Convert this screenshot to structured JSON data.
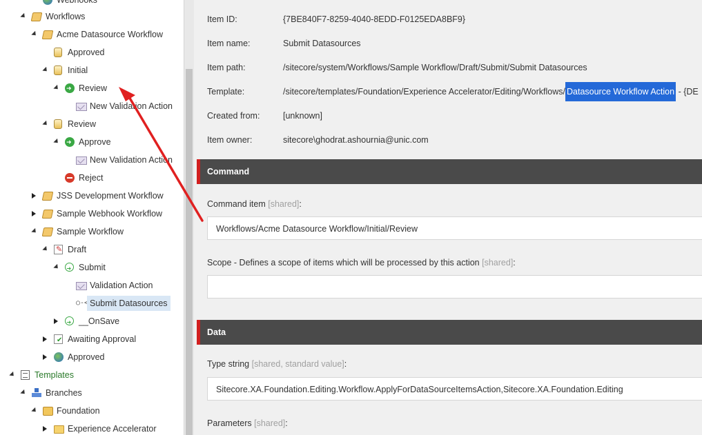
{
  "tree": {
    "nodes": [
      {
        "label": "Webhooks",
        "toggle": "none",
        "icon": "globe-icon"
      },
      {
        "label": "Workflows",
        "toggle": "open",
        "icon": "workflows-folder-icon"
      },
      {
        "label": "Acme Datasource Workflow",
        "toggle": "open",
        "icon": "workflow-icon"
      },
      {
        "label": "Approved",
        "toggle": "none",
        "icon": "workflow-state-icon"
      },
      {
        "label": "Initial",
        "toggle": "open",
        "icon": "workflow-state-icon"
      },
      {
        "label": "Review",
        "toggle": "open",
        "icon": "workflow-command-icon"
      },
      {
        "label": "New Validation Action",
        "toggle": "none",
        "icon": "workflow-action-icon"
      },
      {
        "label": "Review",
        "toggle": "open",
        "icon": "workflow-state-icon"
      },
      {
        "label": "Approve",
        "toggle": "open",
        "icon": "workflow-command-icon"
      },
      {
        "label": "New Validation Action",
        "toggle": "none",
        "icon": "workflow-action-icon"
      },
      {
        "label": "Reject",
        "toggle": "none",
        "icon": "reject-icon"
      },
      {
        "label": "JSS Development Workflow",
        "toggle": "closed",
        "icon": "workflow-icon"
      },
      {
        "label": "Sample Webhook Workflow",
        "toggle": "closed",
        "icon": "workflow-icon"
      },
      {
        "label": "Sample Workflow",
        "toggle": "open",
        "icon": "workflow-icon"
      },
      {
        "label": "Draft",
        "toggle": "open",
        "icon": "draft-icon"
      },
      {
        "label": "Submit",
        "toggle": "open",
        "icon": "workflow-command-outline-icon"
      },
      {
        "label": "Validation Action",
        "toggle": "none",
        "icon": "workflow-action-icon"
      },
      {
        "label": "Submit Datasources",
        "toggle": "none",
        "icon": "connector-icon",
        "selected": true
      },
      {
        "label": "__OnSave",
        "toggle": "closed",
        "icon": "workflow-command-outline-icon"
      },
      {
        "label": "Awaiting Approval",
        "toggle": "closed",
        "icon": "awaiting-approval-icon"
      },
      {
        "label": "Approved",
        "toggle": "closed",
        "icon": "globe-icon"
      },
      {
        "label": "Templates",
        "toggle": "open",
        "icon": "templates-icon"
      },
      {
        "label": "Branches",
        "toggle": "open",
        "icon": "branches-icon"
      },
      {
        "label": "Foundation",
        "toggle": "open",
        "icon": "foundation-folder-icon"
      },
      {
        "label": "Experience Accelerator",
        "toggle": "closed",
        "icon": "folder-icon"
      }
    ]
  },
  "info": {
    "item_id_label": "Item ID:",
    "item_id": "{7BE840F7-8259-4040-8EDD-F0125EDA8BF9}",
    "item_name_label": "Item name:",
    "item_name": "Submit Datasources",
    "item_path_label": "Item path:",
    "item_path": "/sitecore/system/Workflows/Sample Workflow/Draft/Submit/Submit Datasources",
    "template_label": "Template:",
    "template_path": "/sitecore/templates/Foundation/Experience Accelerator/Editing/Workflows/",
    "template_name": "Datasource Workflow Action",
    "template_suffix": " - {DE",
    "created_from_label": "Created from:",
    "created_from": "[unknown]",
    "item_owner_label": "Item owner:",
    "item_owner": "sitecore\\ghodrat.ashournia@unic.com"
  },
  "command_section": {
    "title": "Command",
    "command_item_label": "Command item",
    "command_item_tag": "[shared]",
    "command_item_colon": ":",
    "command_item_value": "Workflows/Acme Datasource Workflow/Initial/Review",
    "scope_label": "Scope - Defines a scope of items which will be processed by this action",
    "scope_tag": "[shared]",
    "scope_colon": ":",
    "scope_value": ""
  },
  "data_section": {
    "title": "Data",
    "type_label": "Type string",
    "type_tag": "[shared, standard value]",
    "type_colon": ":",
    "type_value": "Sitecore.XA.Foundation.Editing.Workflow.ApplyForDataSourceItemsAction,Sitecore.XA.Foundation.Editing",
    "parameters_label": "Parameters",
    "parameters_tag": "[shared]",
    "parameters_colon": ":"
  },
  "colors": {
    "section_header": "#4a4a4a",
    "section_accent": "#d11f1f",
    "highlight": "#2469d8",
    "arrow": "#e02020",
    "tree_selected": "#d9e7f5"
  }
}
